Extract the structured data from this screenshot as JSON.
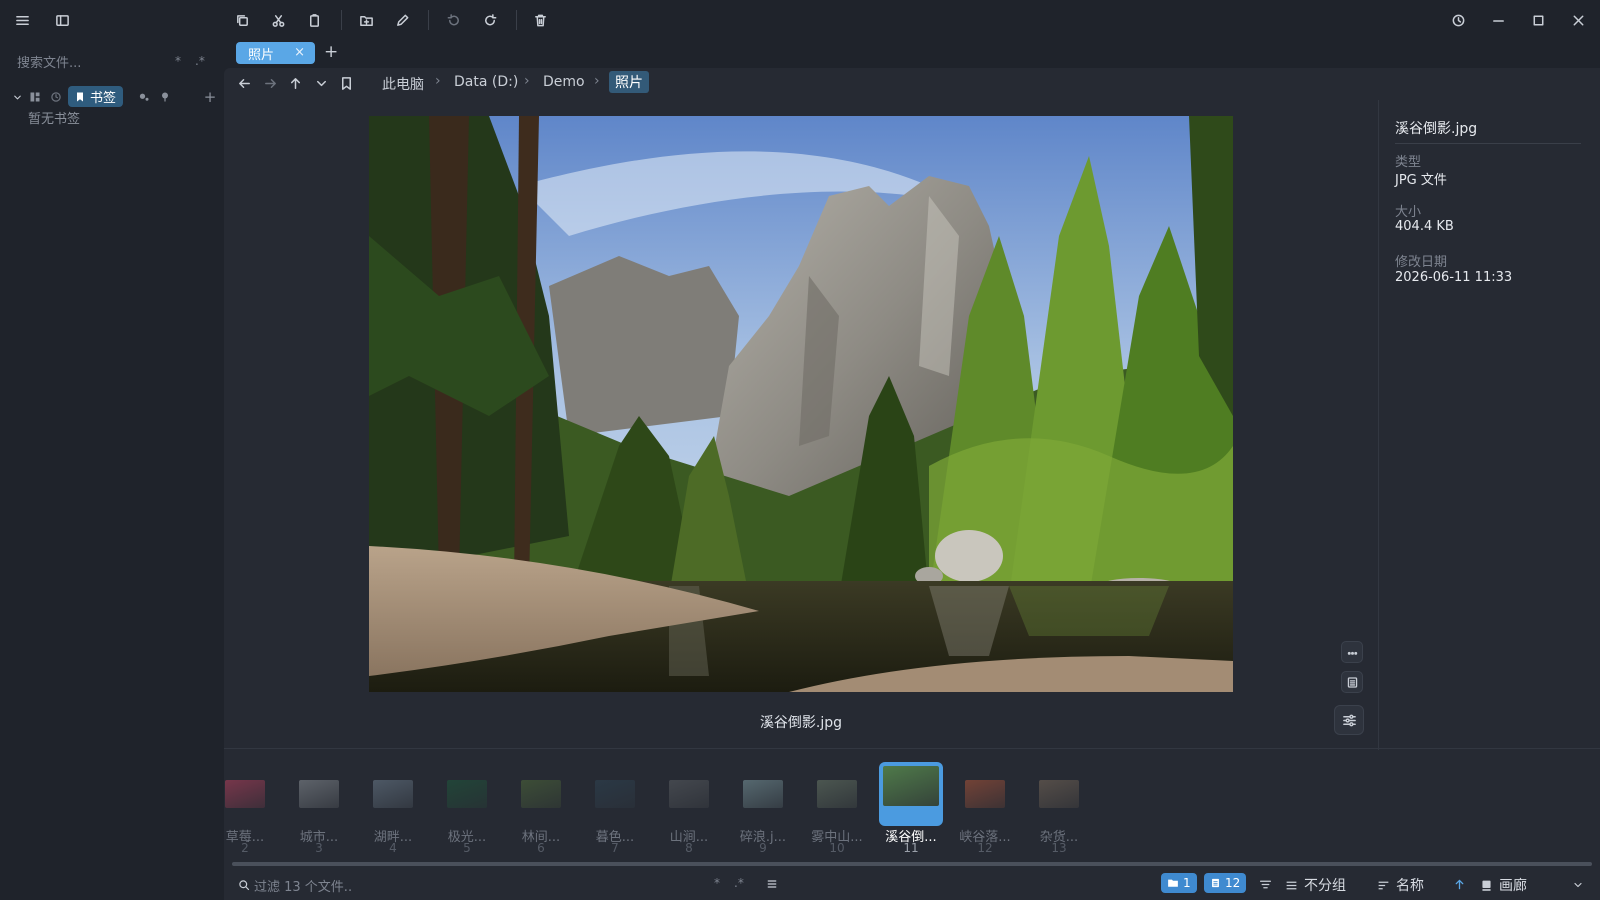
{
  "sidebar": {
    "search_placeholder": "搜索文件...",
    "search_opt_star": "*",
    "search_opt_regex": ".*",
    "bookmark_tab_label": "书签",
    "empty_text": "暂无书签"
  },
  "tabs": [
    {
      "label": "照片",
      "close": "×"
    }
  ],
  "tab_add": "+",
  "breadcrumb": [
    "此电脑",
    "Data (D:)",
    "Demo",
    "照片"
  ],
  "breadcrumb_sep": "›",
  "preview": {
    "caption": "溪谷倒影.jpg"
  },
  "info": {
    "filename": "溪谷倒影.jpg",
    "type_label": "类型",
    "type_value": "JPG 文件",
    "size_label": "大小",
    "size_value": "404.4 KB",
    "date_label": "修改日期",
    "date_value": "2026-06-11 11:33"
  },
  "filmstrip": [
    {
      "name": "草莓...",
      "num": "2",
      "color": "#b8405e"
    },
    {
      "name": "城市...",
      "num": "3",
      "color": "#8a9096"
    },
    {
      "name": "湖畔...",
      "num": "4",
      "color": "#6d7e8e"
    },
    {
      "name": "极光...",
      "num": "5",
      "color": "#1e5a3c"
    },
    {
      "name": "林间...",
      "num": "6",
      "color": "#4f6a3a"
    },
    {
      "name": "暮色...",
      "num": "7",
      "color": "#2f4454"
    },
    {
      "name": "山涧...",
      "num": "8",
      "color": "#5c6064"
    },
    {
      "name": "碎浪.j...",
      "num": "9",
      "color": "#7c9aa0"
    },
    {
      "name": "雾中山...",
      "num": "10",
      "color": "#6a7a68"
    },
    {
      "name": "溪谷倒...",
      "num": "11",
      "color": "#4f7a4a",
      "selected": true
    },
    {
      "name": "峡谷落...",
      "num": "12",
      "color": "#b0563a"
    },
    {
      "name": "杂货...",
      "num": "13",
      "color": "#7a6a5a"
    }
  ],
  "status": {
    "filter_placeholder": "过滤 13 个文件..",
    "filter_star": "*",
    "filter_regex": ".*",
    "folders_count": "1",
    "files_count": "12",
    "group_label": "不分组",
    "sort_label": "名称",
    "view_label": "画廊"
  },
  "colors": {
    "accent": "#5aa7e6",
    "background": "#1f232b",
    "panel": "#262a33"
  }
}
